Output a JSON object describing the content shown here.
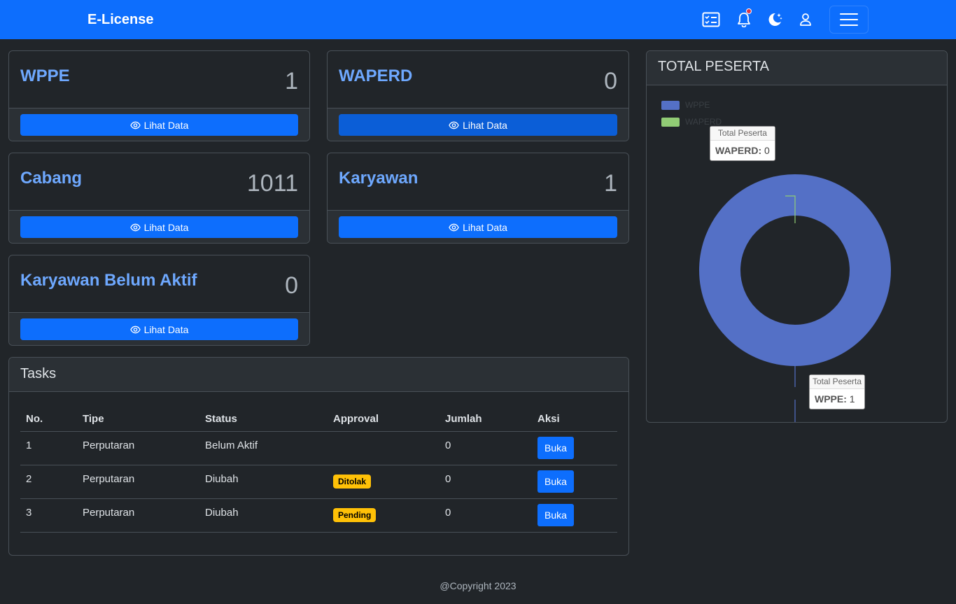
{
  "header": {
    "brand": "E-License",
    "icons": [
      "task-list-icon",
      "bell-icon",
      "moon-stars-icon",
      "user-icon",
      "hamburger-icon"
    ]
  },
  "stats": [
    {
      "title": "WPPE",
      "value": "1",
      "button": "Lihat Data"
    },
    {
      "title": "WAPERD",
      "value": "0",
      "button": "Lihat Data"
    },
    {
      "title": "Cabang",
      "value": "1011",
      "button": "Lihat Data"
    },
    {
      "title": "Karyawan",
      "value": "1",
      "button": "Lihat Data"
    },
    {
      "title": "Karyawan Belum Aktif",
      "value": "0",
      "button": "Lihat Data"
    }
  ],
  "tasks": {
    "title": "Tasks",
    "columns": [
      "No.",
      "Tipe",
      "Status",
      "Approval",
      "Jumlah",
      "Aksi"
    ],
    "rows": [
      {
        "no": "1",
        "tipe": "Perputaran",
        "status": "Belum Aktif",
        "approval": "",
        "jumlah": "0",
        "aksi": "Buka"
      },
      {
        "no": "2",
        "tipe": "Perputaran",
        "status": "Diubah",
        "approval": "Ditolak",
        "jumlah": "0",
        "aksi": "Buka"
      },
      {
        "no": "3",
        "tipe": "Perputaran",
        "status": "Diubah",
        "approval": "Pending",
        "jumlah": "0",
        "aksi": "Buka"
      }
    ]
  },
  "chart_panel": {
    "title": "TOTAL PESERTA"
  },
  "chart_data": {
    "type": "pie",
    "title": "",
    "categories": [
      "WPPE",
      "WAPERD"
    ],
    "values": [
      1,
      0
    ],
    "colors": [
      "#5470c6",
      "#91cc75"
    ],
    "series_name": "Total Peserta",
    "legend_position": "top-left",
    "tooltips": [
      {
        "header": "Total Peserta",
        "label": "WAPERD:",
        "value": "0"
      },
      {
        "header": "Total Peserta",
        "label": "WPPE:",
        "value": "1"
      }
    ]
  },
  "colors": {
    "primary": "#0d6efd",
    "background": "#212529",
    "accent_text": "#6ea8fe",
    "warning": "#ffc107"
  },
  "footer": {
    "text": "@Copyright 2023"
  }
}
